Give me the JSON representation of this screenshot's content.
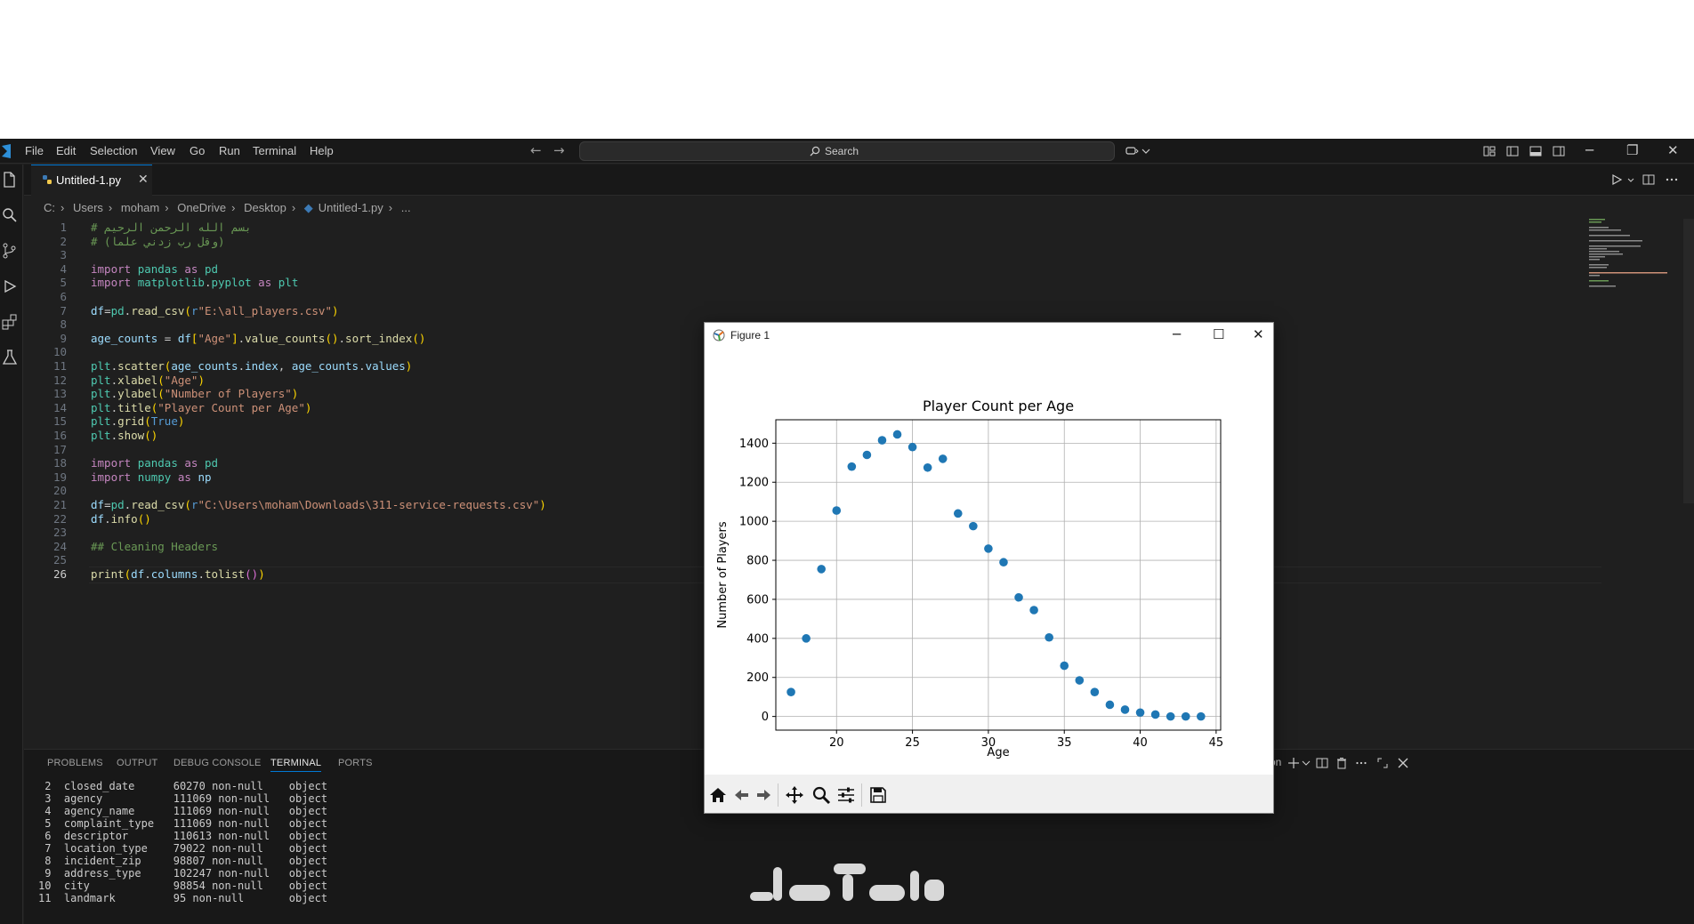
{
  "menu": [
    "File",
    "Edit",
    "Selection",
    "View",
    "Go",
    "Run",
    "Terminal",
    "Help"
  ],
  "search": {
    "placeholder": "Search"
  },
  "tab": {
    "label": "Untitled-1.py"
  },
  "breadcrumb": [
    "C:",
    "Users",
    "moham",
    "OneDrive",
    "Desktop",
    "Untitled-1.py",
    "..."
  ],
  "editor": {
    "current_line": 26,
    "line_numbers": [
      "1",
      "2",
      "3",
      "4",
      "5",
      "6",
      "7",
      "8",
      "9",
      "10",
      "11",
      "12",
      "13",
      "14",
      "15",
      "16",
      "17",
      "18",
      "19",
      "20",
      "21",
      "22",
      "23",
      "24",
      "25",
      "26"
    ],
    "lines": [
      "# بسم الله الرحمن الرحيم",
      "# (وقل رب زدني علما)",
      "",
      "import pandas as pd",
      "import matplotlib.pyplot as plt",
      "",
      "df=pd.read_csv(r\"E:\\all_players.csv\")",
      "",
      "age_counts = df[\"Age\"].value_counts().sort_index()",
      "",
      "plt.scatter(age_counts.index, age_counts.values)",
      "plt.xlabel(\"Age\")",
      "plt.ylabel(\"Number of Players\")",
      "plt.title(\"Player Count per Age\")",
      "plt.grid(True)",
      "plt.show()",
      "",
      "import pandas as pd",
      "import numpy as np",
      "",
      "df=pd.read_csv(r\"C:\\Users\\moham\\Downloads\\311-service-requests.csv\")",
      "df.info()",
      "",
      "## Cleaning Headers",
      "",
      "print(df.columns.tolist())"
    ]
  },
  "panel": {
    "tabs": [
      "PROBLEMS",
      "OUTPUT",
      "DEBUG CONSOLE",
      "TERMINAL",
      "PORTS"
    ],
    "active_tab": "TERMINAL",
    "terminal_profile": "Python",
    "terminal_rows": [
      [
        "2",
        "closed_date",
        "60270 non-null",
        "object"
      ],
      [
        "3",
        "agency",
        "111069 non-null",
        "object"
      ],
      [
        "4",
        "agency_name",
        "111069 non-null",
        "object"
      ],
      [
        "5",
        "complaint_type",
        "111069 non-null",
        "object"
      ],
      [
        "6",
        "descriptor",
        "110613 non-null",
        "object"
      ],
      [
        "7",
        "location_type",
        "79022 non-null",
        "object"
      ],
      [
        "8",
        "incident_zip",
        "98807 non-null",
        "object"
      ],
      [
        "9",
        "address_type",
        "102247 non-null",
        "object"
      ],
      [
        "10",
        "city",
        "98854 non-null",
        "object"
      ],
      [
        "11",
        "landmark",
        "95 non-null",
        "object"
      ]
    ]
  },
  "figure": {
    "window_title": "Figure 1"
  },
  "chart_data": {
    "type": "scatter",
    "title": "Player Count per Age",
    "xlabel": "Age",
    "ylabel": "Number of Players",
    "grid": true,
    "color": "#1f77b4",
    "xlim": [
      16,
      45.3
    ],
    "ylim": [
      -70,
      1520
    ],
    "xticks": [
      20,
      25,
      30,
      35,
      40,
      45
    ],
    "yticks": [
      0,
      200,
      400,
      600,
      800,
      1000,
      1200,
      1400
    ],
    "x": [
      17,
      18,
      19,
      20,
      21,
      22,
      23,
      24,
      25,
      26,
      27,
      28,
      29,
      30,
      31,
      32,
      33,
      34,
      35,
      36,
      37,
      38,
      39,
      40,
      41,
      42,
      43,
      44
    ],
    "y": [
      125,
      400,
      755,
      1055,
      1280,
      1340,
      1415,
      1445,
      1380,
      1275,
      1320,
      1040,
      975,
      860,
      790,
      610,
      545,
      405,
      260,
      185,
      125,
      60,
      35,
      20,
      10,
      0,
      0,
      0
    ]
  },
  "colors": {
    "accent": "#0078d4",
    "editor_bg": "#1f1f1f",
    "scatter": "#1f77b4"
  }
}
